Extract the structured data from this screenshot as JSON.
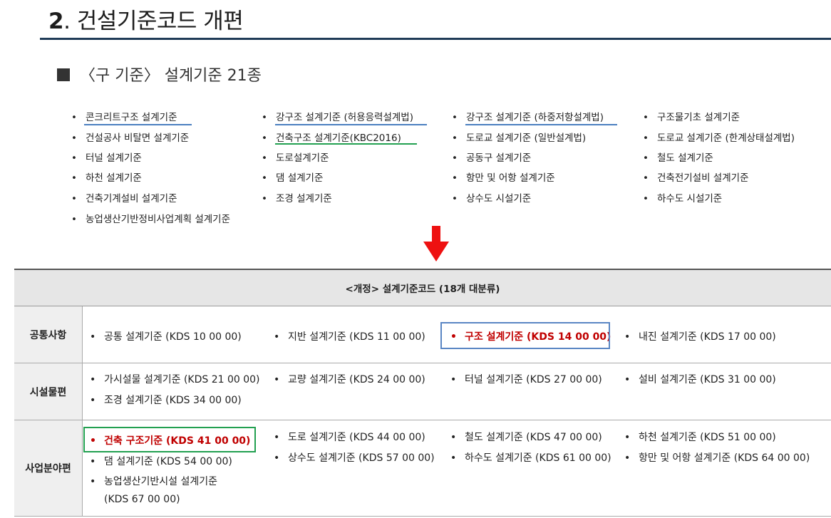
{
  "title": {
    "number": "2",
    "text": ". 건설기준코드 개편"
  },
  "old": {
    "heading": "〈구 기준〉 설계기준 21종",
    "bullet": "•",
    "columns": [
      [
        "콘크리트구조 설계기준",
        "건설공사 비탈면 설계기준",
        "터널 설계기준",
        "하천 설계기준",
        "건축기계설비 설계기준",
        "농업생산기반정비사업계획 설계기준"
      ],
      [
        "강구조 설계기준 (허용응력설계법)",
        "건축구조 설계기준(KBC2016)",
        "도로설계기준",
        "댐 설계기준",
        "조경 설계기준"
      ],
      [
        "강구조 설계기준 (하중저항설계법)",
        "도로교 설계기준 (일반설계법)",
        "공동구 설계기준",
        "항만 및 어항 설계기준",
        "상수도 시설기준"
      ],
      [
        "구조물기초 설계기준",
        "도로교 설계기준 (한계상태설계법)",
        "철도 설계기준",
        "건축전기설비 설계기준",
        "하수도 시설기준"
      ]
    ]
  },
  "new": {
    "header": "<개정> 설계기준코드 (18개 대분류)",
    "rows": [
      {
        "label": "공통사항",
        "items": [
          "공통 설계기준 (KDS 10 00 00)",
          "지반 설계기준 (KDS 11 00 00)",
          "구조 설계기준 (KDS 14 00 00)",
          "내진 설계기준 (KDS 17 00 00)"
        ]
      },
      {
        "label": "시설물편",
        "items": [
          "가시설물 설계기준 (KDS 21 00 00)",
          "교량 설계기준 (KDS 24 00 00)",
          "터널 설계기준 (KDS 27 00 00)",
          "설비 설계기준 (KDS 31 00 00)",
          "조경 설계기준 (KDS 34 00 00)"
        ]
      },
      {
        "label": "사업분야편",
        "items": [
          "건축 구조기준 (KDS 41 00 00)",
          "댐 설계기준 (KDS 54 00 00)",
          "농업생산기반시설 설계기준",
          "(KDS 67 00 00)",
          "도로 설계기준 (KDS 44 00 00)",
          "상수도 설계기준 (KDS 57 00 00)",
          "철도 설계기준 (KDS 47 00 00)",
          "하수도 설계기준 (KDS 61 00 00)",
          "하천 설계기준 (KDS 51 00 00)",
          "항만 및 어항 설계기준 (KDS 64 00 00)"
        ]
      }
    ]
  },
  "colors": {
    "highlight_text": "#c00000",
    "blue_box": "#5a86c4",
    "green_box": "#22a050",
    "arrow": "#ee1111",
    "title_rule": "#1f3b57"
  }
}
